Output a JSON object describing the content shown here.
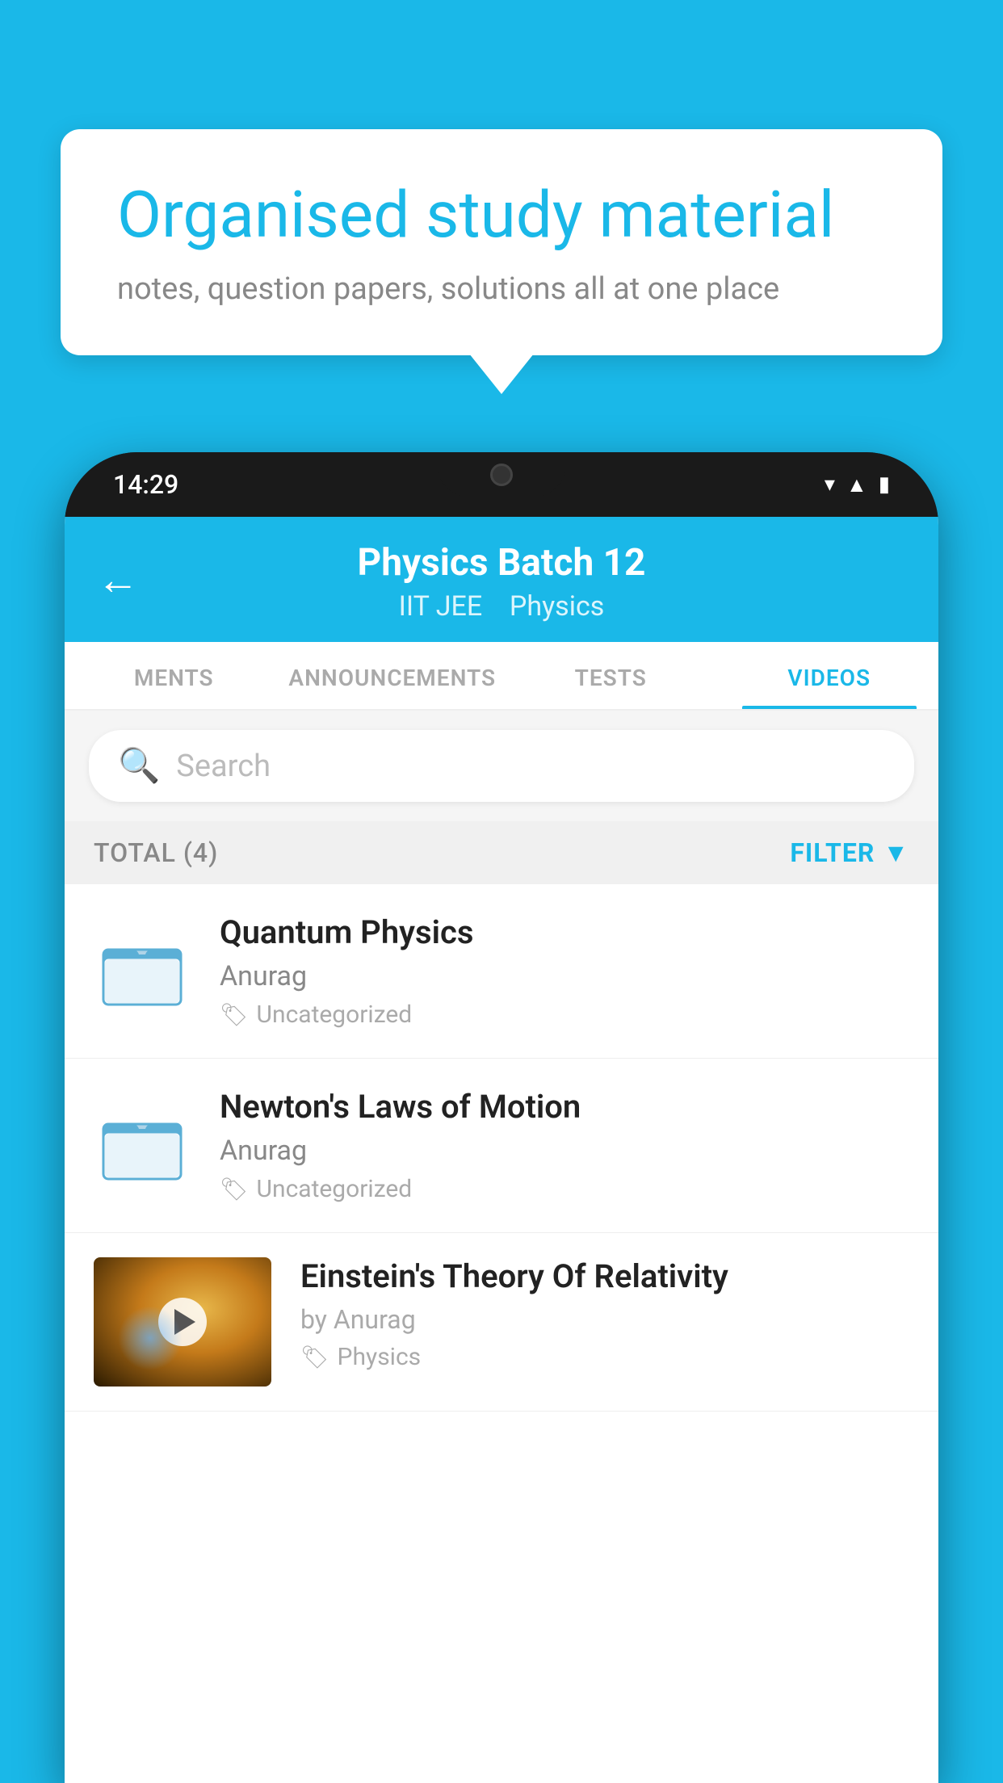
{
  "background_color": "#1ab8e8",
  "speech_bubble": {
    "title": "Organised study material",
    "subtitle": "notes, question papers, solutions all at one place"
  },
  "phone": {
    "time": "14:29",
    "header": {
      "title": "Physics Batch 12",
      "subtitle_parts": [
        "IIT JEE",
        "Physics"
      ],
      "back_label": "←"
    },
    "tabs": [
      {
        "label": "MENTS",
        "active": false
      },
      {
        "label": "ANNOUNCEMENTS",
        "active": false
      },
      {
        "label": "TESTS",
        "active": false
      },
      {
        "label": "VIDEOS",
        "active": true
      }
    ],
    "search": {
      "placeholder": "Search"
    },
    "filter_bar": {
      "total_label": "TOTAL (4)",
      "filter_label": "FILTER"
    },
    "videos": [
      {
        "title": "Quantum Physics",
        "author": "Anurag",
        "tag": "Uncategorized",
        "type": "folder"
      },
      {
        "title": "Newton's Laws of Motion",
        "author": "Anurag",
        "tag": "Uncategorized",
        "type": "folder"
      },
      {
        "title": "Einstein's Theory Of Relativity",
        "author": "by Anurag",
        "tag": "Physics",
        "type": "video"
      }
    ]
  }
}
